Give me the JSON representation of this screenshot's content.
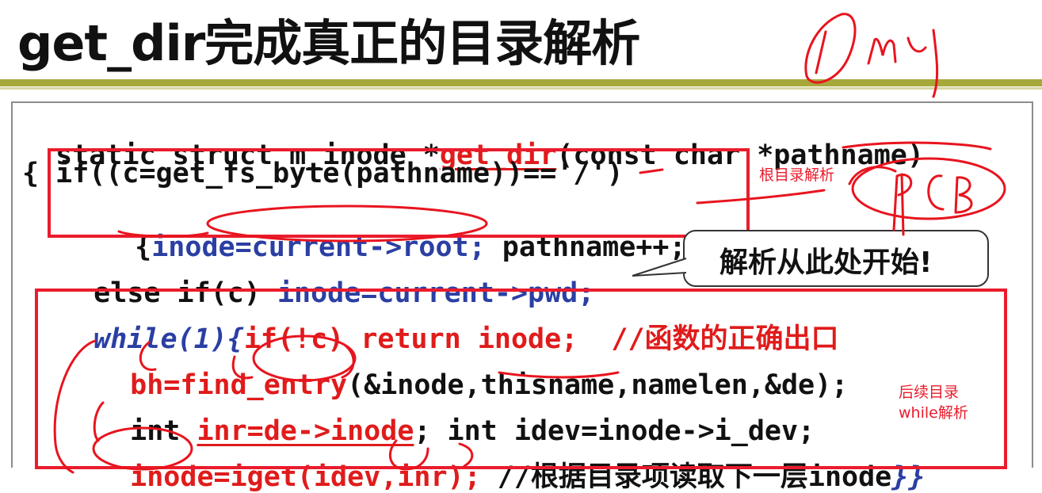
{
  "slide": {
    "title": "get_dir完成真正的目录解析",
    "handwritten_note": "Omy"
  },
  "code": {
    "line1": {
      "prefix": "static struct m_inode *",
      "func": "get_dir",
      "suffix": "(const char *pathname)"
    },
    "line2": "{ if((c=get_fs_byte(pathname))=='/')",
    "line3": {
      "brace": "{",
      "inode_assign": "inode=current->root;",
      "rest": " pathname++;}"
    },
    "line4": {
      "prefix": "else if(c) ",
      "assign": "inode=current->pwd;"
    },
    "line5": {
      "loop": "while(1){",
      "cond": "if(!c) return inode;",
      "comment": "//函数的正确出口"
    },
    "line6": {
      "assign": "bh=find_entry",
      "args": "(&inode,thisname,namelen,&de);"
    },
    "line7": {
      "type": "int ",
      "inr": "inr=de->inode",
      "rest": "; int idev=inode->i_dev;"
    },
    "line8": {
      "assign": "inode=iget(idev,inr);",
      "comment": " //根据目录项读取下一层inode",
      "close": "}}"
    }
  },
  "annotations": {
    "root_parse": "根目录解析",
    "pcb": "PCB",
    "follow_line1": "后续目录",
    "follow_line2": "while解析"
  },
  "callout": {
    "text": "解析从此处开始!"
  },
  "colors": {
    "title_rule": "#a6a83a",
    "highlight_red": "#ea1c2c",
    "code_red": "#e01b1b",
    "code_blue": "#2b3fa3"
  }
}
